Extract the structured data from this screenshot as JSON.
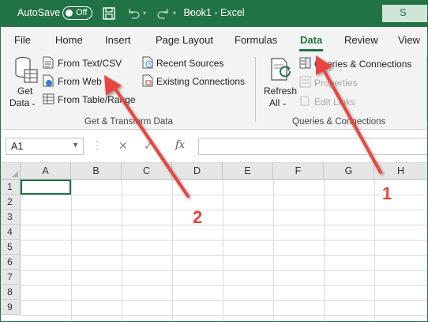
{
  "titlebar": {
    "autosave_label": "AutoSave",
    "autosave_state": "Off",
    "document_title": "Book1  -  Excel",
    "search_glyph": "S"
  },
  "ribbon_tabs": [
    "File",
    "Home",
    "Insert",
    "Page Layout",
    "Formulas",
    "Data",
    "Review",
    "View"
  ],
  "active_tab": "Data",
  "get_transform_group": {
    "get_data_line1": "Get",
    "get_data_line2": "Data",
    "from_text_csv": "From Text/CSV",
    "from_web": "From Web",
    "from_table_range": "From Table/Range",
    "recent_sources": "Recent Sources",
    "existing_connections": "Existing Connections",
    "group_label": "Get & Transform Data"
  },
  "queries_group": {
    "refresh_line1": "Refresh",
    "refresh_line2": "All",
    "queries_connections": "Queries & Connections",
    "properties": "Properties",
    "edit_links": "Edit Links",
    "group_label": "Queries & Connections"
  },
  "formula_bar": {
    "name_box": "A1",
    "cancel_glyph": "✕",
    "enter_glyph": "✓",
    "fx_label": "fx",
    "formula_value": ""
  },
  "sheet": {
    "columns": [
      "A",
      "B",
      "C",
      "D",
      "E",
      "F",
      "G",
      "H"
    ],
    "rows": [
      "1",
      "2",
      "3",
      "4",
      "5",
      "6",
      "7",
      "8",
      "9"
    ],
    "selected_cell": "A1"
  },
  "annotations": {
    "step1": "1",
    "step2": "2",
    "arrow_color": "#e9443f"
  },
  "colors": {
    "excel_green": "#217346",
    "ribbon_bg": "#f3f3f3"
  },
  "icons": [
    "save-icon",
    "undo-icon",
    "redo-icon",
    "customize-qat-icon",
    "search-icon",
    "get-data-icon",
    "text-csv-icon",
    "web-icon",
    "table-range-icon",
    "recent-sources-icon",
    "existing-connections-icon",
    "refresh-all-icon",
    "queries-connections-icon",
    "properties-icon",
    "edit-links-icon",
    "function-icon"
  ]
}
